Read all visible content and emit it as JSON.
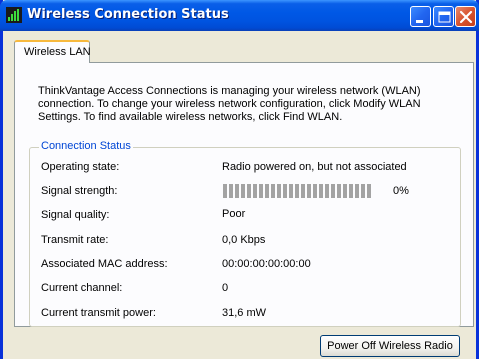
{
  "window": {
    "title": "Wireless Connection Status",
    "buttons": [
      "minimize",
      "maximize",
      "close"
    ]
  },
  "tabs": [
    {
      "label": "Wireless LAN",
      "selected": true
    }
  ],
  "description": "ThinkVantage Access Connections is managing your wireless network (WLAN) connection. To change your wireless network configuration, click Modify WLAN Settings. To find available wireless networks, click Find WLAN.",
  "connection_status": {
    "title": "Connection Status",
    "rows": [
      {
        "label": "Operating state:",
        "value": "Radio powered on, but not associated"
      },
      {
        "label": "Signal strength:",
        "value": "0%"
      },
      {
        "label": "Signal quality:",
        "value": "Poor"
      },
      {
        "label": "Transmit rate:",
        "value": "0,0 Kbps"
      },
      {
        "label": "Associated MAC address:",
        "value": "00:00:00:00:00:00"
      },
      {
        "label": "Current channel:",
        "value": "0"
      },
      {
        "label": "Current transmit power:",
        "value": "31,6 mW"
      }
    ],
    "signal_level": 0
  },
  "actions": {
    "power_off_label": "Power Off Wireless Radio"
  },
  "colors": {
    "titlebar": "#0054e3",
    "group_title": "#0046d5",
    "close_button": "#d8542f",
    "tab_highlight": "#f7b93d"
  },
  "icons": {
    "app": "signal-strength-icon",
    "minimize": "minimize-icon",
    "maximize": "maximize-icon",
    "close": "close-icon"
  }
}
